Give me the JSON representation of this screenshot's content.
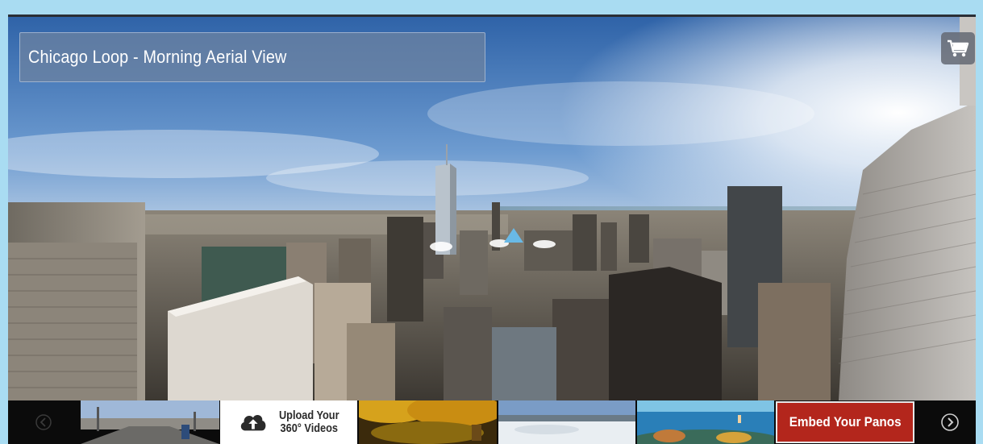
{
  "viewer": {
    "title": "Chicago Loop - Morning Aerial View",
    "cart_icon": "shopping-cart-icon"
  },
  "strip": {
    "prev_icon": "chevron-left-circle-icon",
    "next_icon": "chevron-right-circle-icon",
    "upload_label_line1": "Upload Your",
    "upload_label_line2": "360° Videos",
    "upload_icon": "cloud-upload-icon",
    "embed_label": "Embed Your Panos",
    "thumbnails": [
      "street-panorama",
      "autumn-forest-panorama",
      "snow-field-panorama",
      "underwater-reef-panorama"
    ]
  },
  "colors": {
    "background": "#a9dcf2",
    "embed_red": "#b3261c",
    "strip_black": "#0b0b0b"
  }
}
